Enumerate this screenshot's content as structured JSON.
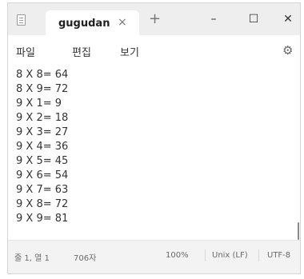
{
  "titlebar": {
    "app_icon": "notepad-icon",
    "tab_title": "gugudan",
    "tab_close": "×",
    "new_tab": "+",
    "minimize": "–",
    "maximize": "☐",
    "close": "✕"
  },
  "menu": {
    "file": "파일",
    "edit": "편집",
    "view": "보기",
    "settings_icon": "⚙"
  },
  "editor": {
    "lines": [
      "8 X 8= 64",
      "8 X 9= 72",
      "9 X 1= 9",
      "9 X 2= 18",
      "9 X 3= 27",
      "9 X 4= 36",
      "9 X 5= 45",
      "9 X 6= 54",
      "9 X 7= 63",
      "9 X 8= 72",
      "9 X 9= 81"
    ]
  },
  "status": {
    "position": "줄 1, 열 1",
    "chars": "706자",
    "zoom": "100%",
    "line_ending": "Unix (LF)",
    "encoding": "UTF-8"
  }
}
